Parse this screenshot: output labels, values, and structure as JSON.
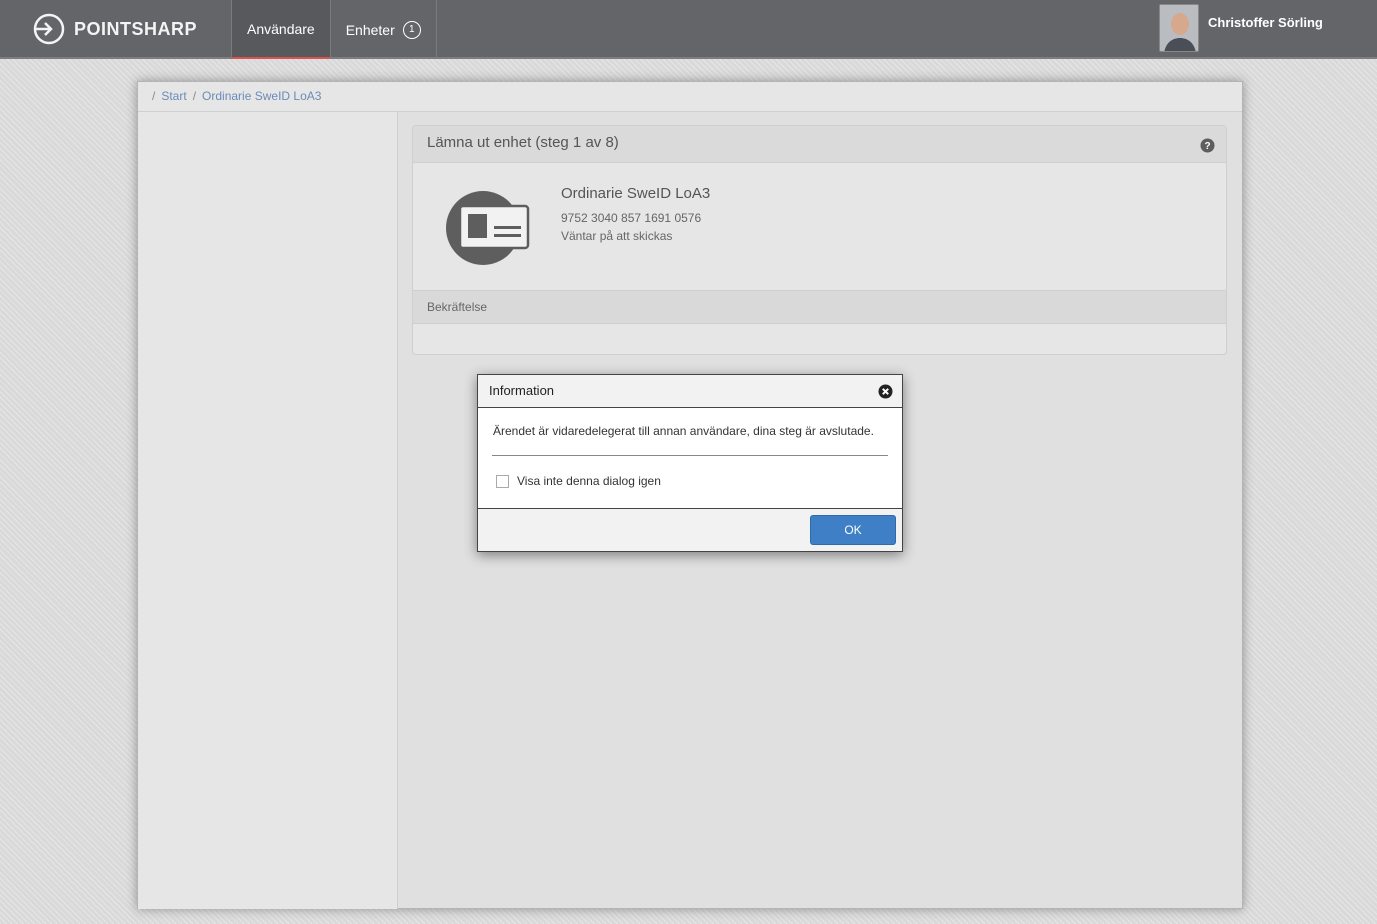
{
  "topbar": {
    "logo_text": "POINTSHARP",
    "nav": [
      {
        "label": "Användare",
        "active": true
      },
      {
        "label": "Enheter",
        "badge": "1"
      }
    ],
    "user": {
      "name": "Christoffer Sörling"
    }
  },
  "breadcrumb": {
    "separator": "/",
    "items": [
      "Start",
      "Ordinarie SweID LoA3"
    ]
  },
  "card": {
    "title": "Lämna ut enhet (steg 1 av 8)",
    "help_icon": "question-circle-icon",
    "device": {
      "icon": "id-card-icon",
      "name": "Ordinarie SweID LoA3",
      "number": "9752 3040 857 1691 0576",
      "status": "Väntar på att skickas"
    },
    "confirmation_label": "Bekräftelse"
  },
  "dialog": {
    "title": "Information",
    "message": "Ärendet är vidaredelegerat till annan användare, dina steg är avslutade.",
    "checkbox_label": "Visa inte denna dialog igen",
    "checkbox_checked": false,
    "ok_label": "OK"
  },
  "colors": {
    "topbar": "#646569",
    "accent_underline": "#d9534f",
    "link": "#6a8bb8",
    "primary_button": "#3e7fc6"
  }
}
